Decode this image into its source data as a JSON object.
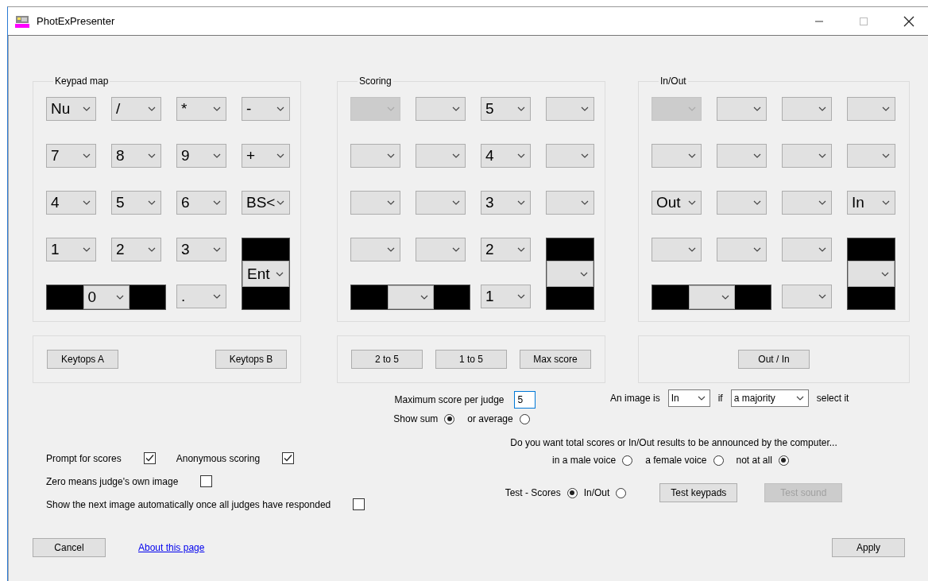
{
  "window": {
    "title": "PhotExPresenter"
  },
  "panels": [
    {
      "title": "Keypad map",
      "cells": [
        {
          "kind": "combo",
          "value": "Nu",
          "disabled": false
        },
        {
          "kind": "combo",
          "value": "/",
          "disabled": false
        },
        {
          "kind": "combo",
          "value": "*",
          "disabled": false
        },
        {
          "kind": "combo",
          "value": "-",
          "disabled": false
        },
        {
          "kind": "combo",
          "value": "7",
          "disabled": false
        },
        {
          "kind": "combo",
          "value": "8",
          "disabled": false
        },
        {
          "kind": "combo",
          "value": "9",
          "disabled": false
        },
        {
          "kind": "combo",
          "value": "+",
          "disabled": false
        },
        {
          "kind": "combo",
          "value": "4",
          "disabled": false
        },
        {
          "kind": "combo",
          "value": "5",
          "disabled": false
        },
        {
          "kind": "combo",
          "value": "6",
          "disabled": false
        },
        {
          "kind": "combo",
          "value": "BS<",
          "disabled": false
        },
        {
          "kind": "combo",
          "value": "1",
          "disabled": false
        },
        {
          "kind": "combo",
          "value": "2",
          "disabled": false
        },
        {
          "kind": "combo",
          "value": "3",
          "disabled": false
        },
        {
          "kind": "tall",
          "value": "Ent",
          "disabled": false
        },
        {
          "kind": "wide",
          "value": "0",
          "disabled": false
        },
        {
          "kind": "combo",
          "value": ".",
          "disabled": false
        }
      ],
      "buttons": [
        "Keytops A",
        "Keytops B"
      ]
    },
    {
      "title": "Scoring",
      "cells": [
        {
          "kind": "combo",
          "disabled": true
        },
        {
          "kind": "combo",
          "disabled": false
        },
        {
          "kind": "combo",
          "value": "5",
          "disabled": false
        },
        {
          "kind": "combo",
          "disabled": false
        },
        {
          "kind": "combo",
          "disabled": false
        },
        {
          "kind": "combo",
          "disabled": false
        },
        {
          "kind": "combo",
          "value": "4",
          "disabled": false
        },
        {
          "kind": "combo",
          "disabled": false
        },
        {
          "kind": "combo",
          "disabled": false
        },
        {
          "kind": "combo",
          "disabled": false
        },
        {
          "kind": "combo",
          "value": "3",
          "disabled": false
        },
        {
          "kind": "combo",
          "disabled": false
        },
        {
          "kind": "combo",
          "disabled": false
        },
        {
          "kind": "combo",
          "disabled": false
        },
        {
          "kind": "combo",
          "value": "2",
          "disabled": false
        },
        {
          "kind": "tall",
          "disabled": false
        },
        {
          "kind": "wide",
          "disabled": false
        },
        {
          "kind": "combo",
          "value": "1",
          "disabled": false
        }
      ],
      "buttons": [
        "2 to 5",
        "1 to 5",
        "Max score"
      ]
    },
    {
      "title": "In/Out",
      "cells": [
        {
          "kind": "combo",
          "disabled": true
        },
        {
          "kind": "combo",
          "disabled": false
        },
        {
          "kind": "combo",
          "disabled": false
        },
        {
          "kind": "combo",
          "disabled": false
        },
        {
          "kind": "combo",
          "disabled": false
        },
        {
          "kind": "combo",
          "disabled": false
        },
        {
          "kind": "combo",
          "disabled": false
        },
        {
          "kind": "combo",
          "disabled": false
        },
        {
          "kind": "combo",
          "value": "Out",
          "disabled": false
        },
        {
          "kind": "combo",
          "disabled": false
        },
        {
          "kind": "combo",
          "disabled": false
        },
        {
          "kind": "combo",
          "value": "In",
          "disabled": false
        },
        {
          "kind": "combo",
          "disabled": false
        },
        {
          "kind": "combo",
          "disabled": false
        },
        {
          "kind": "combo",
          "disabled": false
        },
        {
          "kind": "tall",
          "disabled": false
        },
        {
          "kind": "wide",
          "disabled": false
        },
        {
          "kind": "combo",
          "disabled": false
        }
      ],
      "buttons": [
        "Out / In"
      ]
    }
  ],
  "scoring_options": {
    "max_score_label": "Maximum score per judge",
    "max_score": "5",
    "display": [
      {
        "label": "Show sum",
        "selected": true
      },
      {
        "label": "or average",
        "selected": false
      }
    ]
  },
  "in_out_rule": {
    "prefix": "An image is",
    "state": "In",
    "joiner": "if",
    "rule": "a majority",
    "suffix": "select it"
  },
  "checkbox_rows": [
    [
      {
        "label": "Prompt for scores",
        "checked": true
      },
      {
        "label": "Anonymous scoring",
        "checked": true
      }
    ],
    [
      {
        "label": "Zero means judge's own image",
        "checked": false
      }
    ],
    [
      {
        "label": "Show the next image automatically once all judges have responded",
        "checked": false
      }
    ]
  ],
  "announce": {
    "question": "Do you want total scores or In/Out results to be announced by the computer...",
    "voices": [
      {
        "label": "in a male voice",
        "selected": false
      },
      {
        "label": "a female voice",
        "selected": false
      },
      {
        "label": "not at all",
        "selected": true
      }
    ]
  },
  "test": {
    "modes": [
      {
        "label": "Test - Scores",
        "selected": true
      },
      {
        "label": "In/Out",
        "selected": false
      }
    ],
    "buttons": [
      {
        "label": "Test keypads",
        "disabled": false
      },
      {
        "label": "Test sound",
        "disabled": true
      }
    ]
  },
  "footer": {
    "cancel": "Cancel",
    "link": "About this page",
    "apply": "Apply"
  }
}
